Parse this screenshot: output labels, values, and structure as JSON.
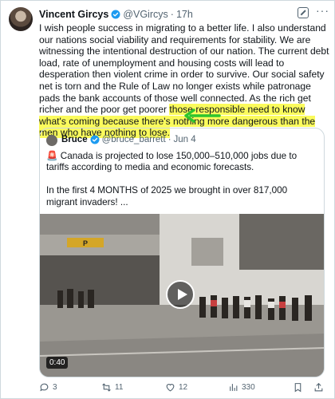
{
  "author": {
    "name": "Vincent Gircys",
    "handle": "@VGircys",
    "separator": "·",
    "time": "17h"
  },
  "tweet": {
    "text_a": "I wish people success in migrating to a better life. I also understand our nations social viability and requirements for stability. We are witnessing the intentional destruction of our nation. The current debt load, rate of unemployment and housing costs will lead to desperation then violent crime in order to survive. Our social safety net is torn and the Rule of Law no longer exists while patronage pads the bank accounts of those well connected.  As the rich get richer and the poor get poorer ",
    "text_highlight": "those responsible need to know what's coming because there's nothing more dangerous than the men who have nothing to lose.",
    "highlight_color": "#fbfb5c",
    "arrow_color": "#2ec52e"
  },
  "quote": {
    "name": "Bruce",
    "handle": "@bruce_barrett",
    "separator": "·",
    "date": "Jun 4",
    "text": "🚨 Canada is projected to lose 150,000–510,000 jobs due to tariffs according to media and economic forecasts.\n\nIn the first 4 MONTHS of 2025 we brought in over 817,000 migrant invaders!  ...",
    "video_duration": "0:40",
    "video_sign": "P"
  },
  "actions": {
    "replies": "3",
    "reposts": "11",
    "likes": "12",
    "views": "330"
  },
  "colors": {
    "verified": "#1d9bf0",
    "text": "#0f1419",
    "muted": "#536471"
  }
}
